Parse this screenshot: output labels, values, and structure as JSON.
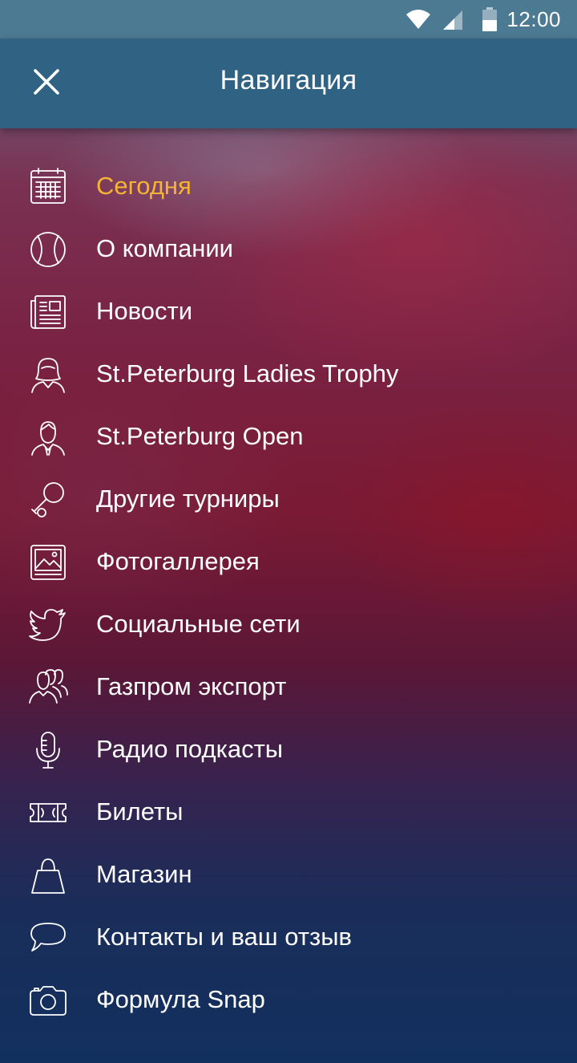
{
  "status_bar": {
    "time": "12:00",
    "icons": [
      "wifi-icon",
      "signal-icon",
      "battery-icon"
    ]
  },
  "app_bar": {
    "title": "Навигация",
    "close_icon": "close-icon"
  },
  "colors": {
    "status_bar": "#4d7a93",
    "app_bar": "#2f6283",
    "active_item": "#f5b433",
    "text": "#ffffff"
  },
  "menu": {
    "active_index": 0,
    "items": [
      {
        "label": "Сегодня",
        "icon": "calendar-icon"
      },
      {
        "label": "О компании",
        "icon": "tennis-ball-icon"
      },
      {
        "label": "Новости",
        "icon": "newspaper-icon"
      },
      {
        "label": "St.Peterburg Ladies Trophy",
        "icon": "woman-icon"
      },
      {
        "label": "St.Peterburg Open",
        "icon": "man-icon"
      },
      {
        "label": "Другие турниры",
        "icon": "tennis-racket-icon"
      },
      {
        "label": "Фотогаллерея",
        "icon": "photo-gallery-icon"
      },
      {
        "label": "Социальные сети",
        "icon": "twitter-bird-icon"
      },
      {
        "label": "Газпром экспорт",
        "icon": "people-group-icon"
      },
      {
        "label": "Радио подкасты",
        "icon": "microphone-icon"
      },
      {
        "label": "Билеты",
        "icon": "ticket-icon"
      },
      {
        "label": "Магазин",
        "icon": "shopping-bag-icon"
      },
      {
        "label": "Контакты и ваш отзыв",
        "icon": "speech-bubble-icon"
      },
      {
        "label": "Формула Snap",
        "icon": "camera-icon"
      }
    ]
  }
}
